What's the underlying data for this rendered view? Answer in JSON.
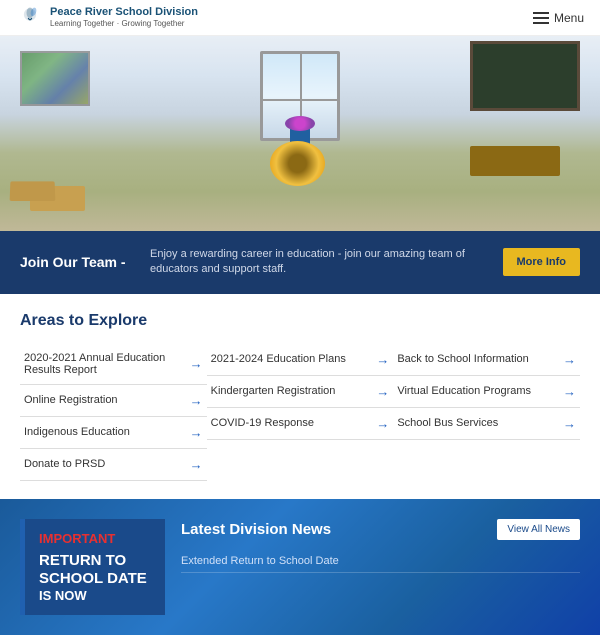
{
  "header": {
    "logo_title": "Peace River School Division",
    "logo_subtitle": "Learning Together · Growing Together",
    "menu_label": "Menu"
  },
  "hero": {
    "alt": "Classroom with desks, flowers and chalkboard"
  },
  "join_banner": {
    "title": "Join Our Team -",
    "description": "Enjoy a rewarding career in education - join our amazing team of educators and support staff.",
    "button_label": "More Info"
  },
  "areas": {
    "section_title": "Areas to Explore",
    "columns": [
      [
        "2020-2021 Annual Education Results Report",
        "Online Registration",
        "Indigenous Education",
        "Donate to PRSD"
      ],
      [
        "2021-2024 Education Plans",
        "Kindergarten Registration",
        "COVID-19 Response"
      ],
      [
        "Back to School Information",
        "Virtual Education Programs",
        "School Bus Services"
      ]
    ]
  },
  "bottom": {
    "important_label": "IMPORTANT",
    "return_line1": "RETURN TO",
    "return_line2": "SCHOOL DATE",
    "return_line3": "IS NOW",
    "news_title": "Latest Division News",
    "view_all_label": "View All News",
    "news_items": [
      "Extended Return to School Date"
    ]
  }
}
